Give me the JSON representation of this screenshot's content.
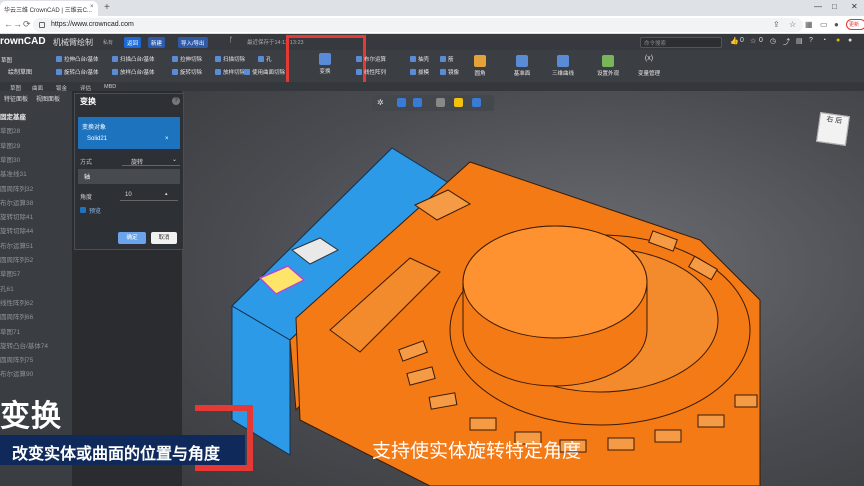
{
  "browser": {
    "tab_title": "华云三维 CrownCAD | 三维云C...",
    "tab_close": "×",
    "new_tab": "+",
    "url": "https://www.crowncad.com",
    "red_pill": "更新"
  },
  "app": {
    "brand": "rownCAD",
    "doc_name": "机械臂绘制",
    "doc_badge": "私有",
    "buttons": {
      "back": "返回",
      "new": "新建",
      "import_export": "导入/导出"
    },
    "save_info": "最近保存于14:13 13:23",
    "search_placeholder": "命令搜索",
    "header_counts": {
      "like": "0",
      "star": "0"
    }
  },
  "ribbon": {
    "left_groups": [
      {
        "label": "草图",
        "sub": "绘制草图"
      },
      {
        "label": "拉伸凸台/基体"
      },
      {
        "label": "旋转凸台/基体"
      },
      {
        "label": "扫描凸台/基体"
      },
      {
        "label": "放样凸台/基体"
      },
      {
        "label": "拉伸切除"
      },
      {
        "label": "旋转切除"
      },
      {
        "label": "扫描切除"
      },
      {
        "label": "放样切除"
      },
      {
        "label": "孔"
      },
      {
        "label": "使用曲面切除"
      }
    ],
    "transform": "变换",
    "ops": [
      "布尔运算",
      "抽壳",
      "筋",
      "线性阵列",
      "拔模",
      "镜像",
      "圆角",
      "基准面",
      "三维曲线",
      "设置外观",
      "变量管理"
    ],
    "tabs": [
      "草图",
      "曲面",
      "钣金",
      "评估",
      "MBD"
    ]
  },
  "sidepanel": {
    "tabs": [
      "特征面板",
      "视图面板"
    ],
    "items": [
      "固定基座",
      "草图28",
      "草图29",
      "草图30",
      "基准线31",
      "圆周阵列32",
      "布尔运算38",
      "旋转切除41",
      "旋转切除44",
      "布尔运算51",
      "圆周阵列52",
      "草图57",
      "孔61",
      "线性阵列62",
      "圆周阵列66",
      "草图71",
      "旋转凸台/基体74",
      "圆周阵列75",
      "布尔运算90"
    ]
  },
  "dialog": {
    "title": "变换",
    "help": "?",
    "select_label": "变换对象",
    "selected": "Solid21",
    "remove": "×",
    "mode_label": "方式",
    "mode_value": "旋转",
    "axis_label": "轴",
    "angle_label": "角度",
    "angle_value": "10",
    "preview_label": "预览",
    "ok": "确定",
    "cancel": "取消"
  },
  "viewcube": {
    "face": "右",
    "back": "后"
  },
  "captions": {
    "main": "变换",
    "sub": "改变实体或曲面的位置与角度",
    "right": "支持使实体旋转特定角度"
  }
}
